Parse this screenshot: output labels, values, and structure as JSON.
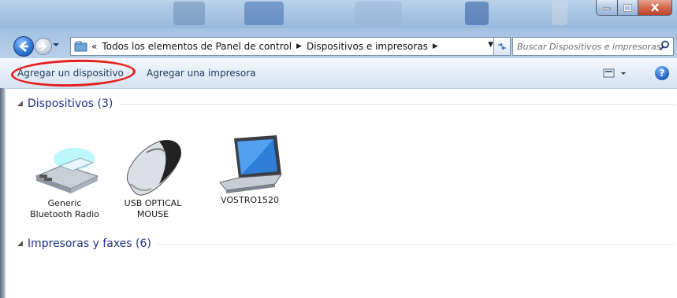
{
  "window": {
    "caption_buttons": {
      "minimize_icon": "minimize-icon",
      "maximize_icon": "maximize-icon",
      "close_icon": "close-icon"
    }
  },
  "address_bar": {
    "prefix": "«",
    "segments": [
      "Todos los elementos de Panel de control",
      "Dispositivos e impresoras"
    ]
  },
  "search": {
    "placeholder": "Buscar Dispositivos e impresoras"
  },
  "toolbar": {
    "add_device_label": "Agregar un dispositivo",
    "add_printer_label": "Agregar una impresora",
    "help_label": "?"
  },
  "groups": {
    "devices": {
      "header": "Dispositivos (3)",
      "items": [
        {
          "label_line1": "Generic",
          "label_line2": "Bluetooth Radio",
          "icon": "bluetooth-usb-icon"
        },
        {
          "label_line1": "USB OPTICAL",
          "label_line2": "MOUSE",
          "icon": "mouse-icon"
        },
        {
          "label_line1": "VOSTRO1520",
          "label_line2": "",
          "icon": "laptop-icon"
        }
      ]
    },
    "printers": {
      "header": "Impresoras y faxes (6)"
    }
  },
  "colors": {
    "highlight_oval": "#e41f1f",
    "link_text": "#1e395b",
    "group_header": "#1e3287"
  }
}
